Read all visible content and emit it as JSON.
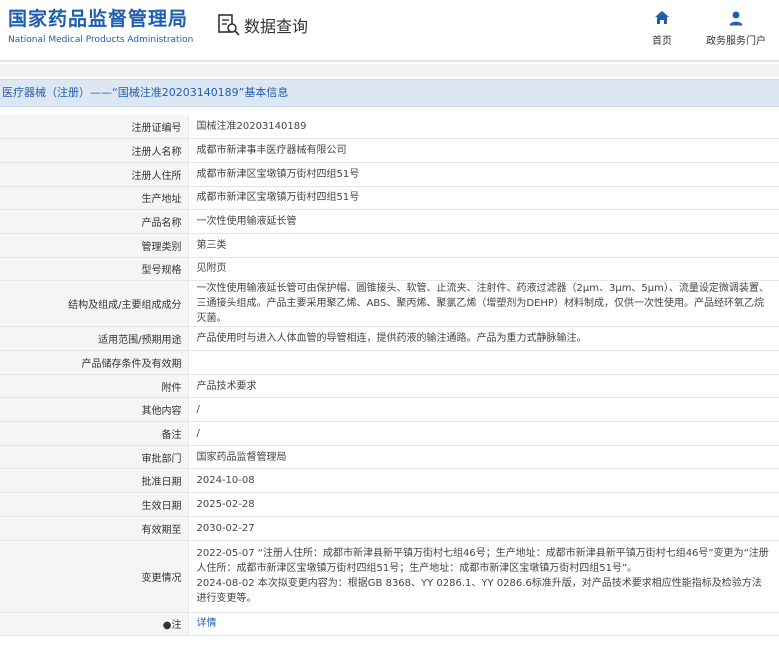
{
  "header": {
    "logo_cn": "国家药品监督管理局",
    "logo_en": "National Medical Products Administration",
    "query_label": "数据查询",
    "nav": [
      {
        "label": "首页",
        "icon": "home-icon"
      },
      {
        "label": "政务服务门户",
        "icon": "user-icon"
      }
    ]
  },
  "title": "医疗器械（注册）——“国械注准20203140189”基本信息",
  "rows": [
    {
      "label": "注册证编号",
      "value": "国械注准20203140189"
    },
    {
      "label": "注册人名称",
      "value": "成都市新津事丰医疗器械有限公司"
    },
    {
      "label": "注册人住所",
      "value": "成都市新津区宝墩镇万街村四组51号"
    },
    {
      "label": "生产地址",
      "value": "成都市新津区宝墩镇万街村四组51号"
    },
    {
      "label": "产品名称",
      "value": "一次性使用输液延长管"
    },
    {
      "label": "管理类别",
      "value": "第三类"
    },
    {
      "label": "型号规格",
      "value": "见附页"
    },
    {
      "label": "结构及组成/主要组成成分",
      "value": "一次性使用输液延长管可由保护帽、圆锥接头、软管、止流夹、注射件、药液过滤器（2μm、3μm、5μm）、流量设定微调装置、三通接头组成。产品主要采用聚乙烯、ABS、聚丙烯、聚氯乙烯（增塑剂为DEHP）材料制成，仅供一次性使用。产品经环氧乙烷灭菌。"
    },
    {
      "label": "适用范围/预期用途",
      "value": "产品使用时与进入人体血管的导管相连，提供药液的输注通路。产品为重力式静脉输注。"
    },
    {
      "label": "产品储存条件及有效期",
      "value": ""
    },
    {
      "label": "附件",
      "value": "产品技术要求"
    },
    {
      "label": "其他内容",
      "value": "/"
    },
    {
      "label": "备注",
      "value": "/"
    },
    {
      "label": "审批部门",
      "value": "国家药品监督管理局"
    },
    {
      "label": "批准日期",
      "value": "2024-10-08"
    },
    {
      "label": "生效日期",
      "value": "2025-02-28"
    },
    {
      "label": "有效期至",
      "value": "2030-02-27"
    },
    {
      "label": "变更情况",
      "value": "2022-05-07 “注册人住所：成都市新津县新平镇万街村七组46号；生产地址：成都市新津县新平镇万街村七组46号”变更为“注册人住所：成都市新津区宝墩镇万街村四组51号；生产地址：成都市新津区宝墩镇万街村四组51号”。\n2024-08-02 本次拟变更内容为：根据GB 8368、YY 0286.1、YY 0286.6标准升版，对产品技术要求相应性能指标及检验方法进行变更等。"
    },
    {
      "label": "●注",
      "value": "详情"
    }
  ]
}
